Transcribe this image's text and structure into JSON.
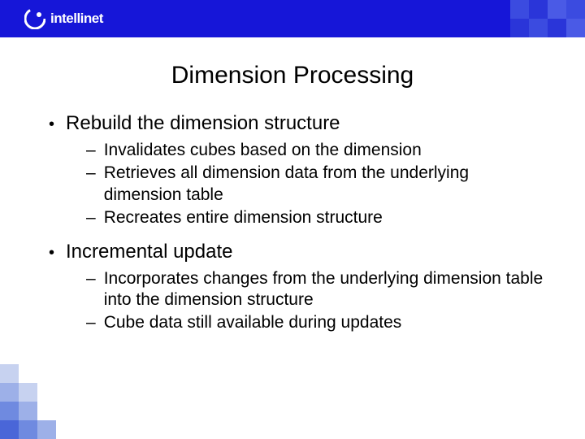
{
  "brand": "intellinet",
  "title": "Dimension Processing",
  "bullets": [
    {
      "label": "Rebuild the dimension structure",
      "subs": [
        "Invalidates cubes based on the dimension",
        "Retrieves all dimension data from the underlying dimension table",
        "Recreates entire dimension structure"
      ]
    },
    {
      "label": "Incremental update",
      "subs": [
        "Incorporates changes from the underlying dimension table into the dimension structure",
        "Cube data still available during updates"
      ]
    }
  ]
}
